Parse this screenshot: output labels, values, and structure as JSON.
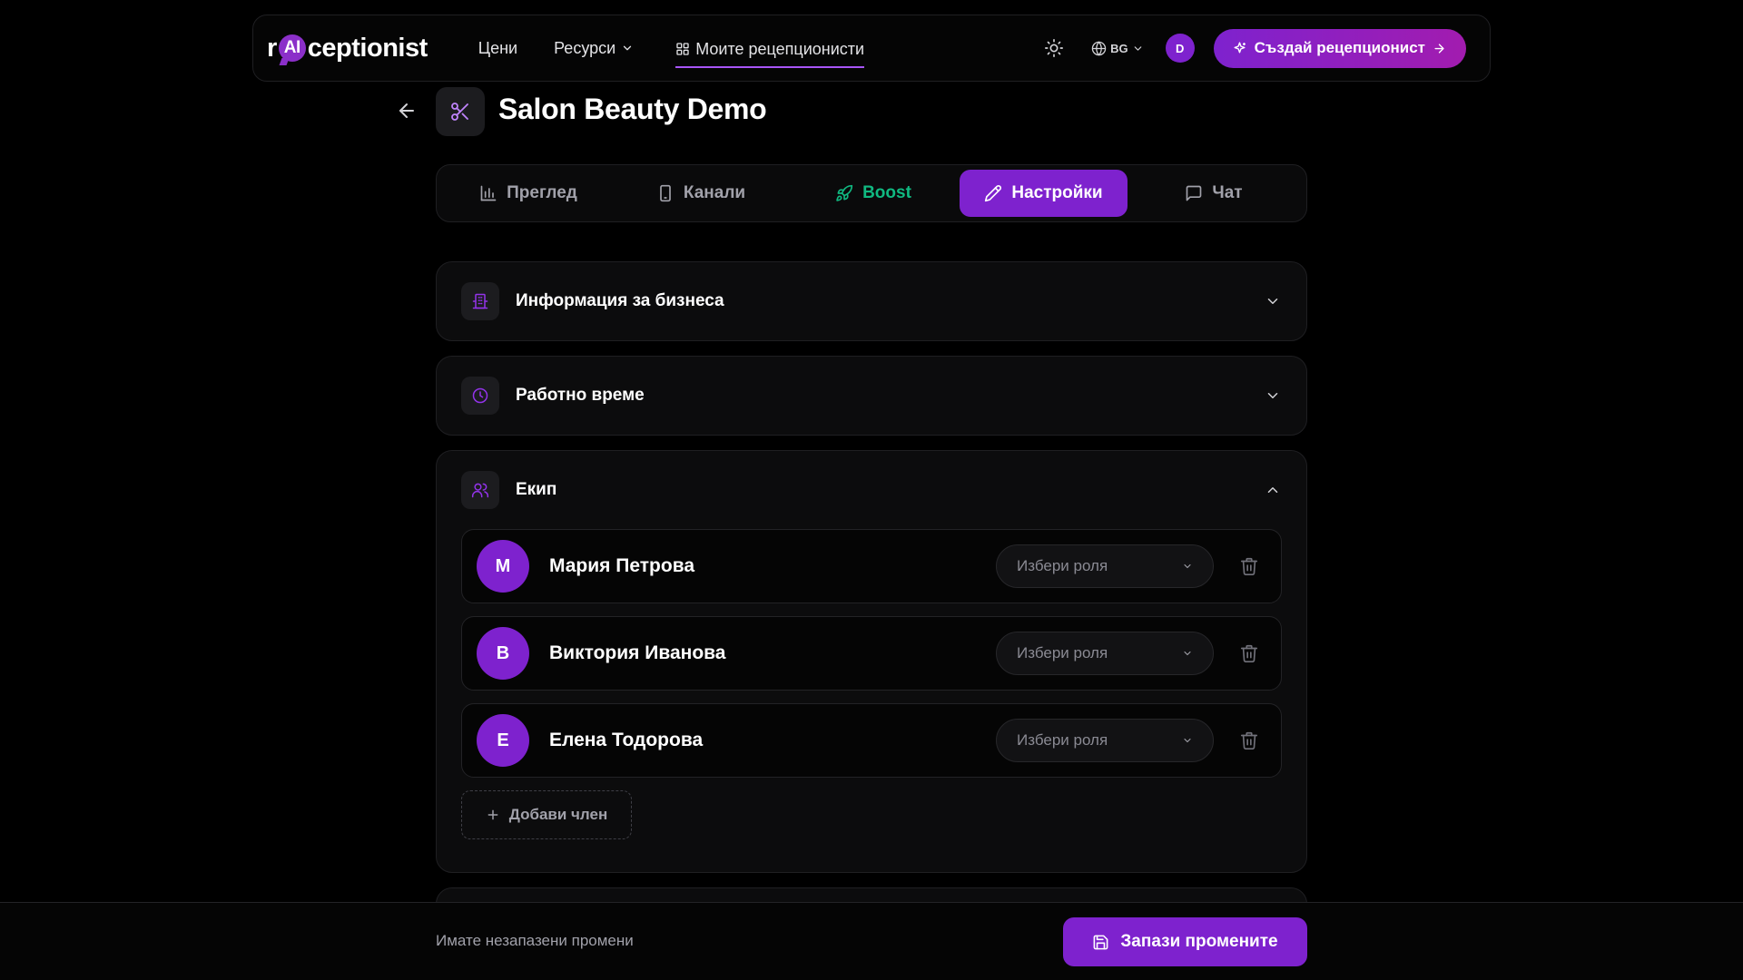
{
  "nav": {
    "logo": {
      "prefix": "r",
      "ai": "AI",
      "suffix": "ceptionist"
    },
    "links": [
      "Цени",
      "Ресурси",
      "Моите рецепционисти"
    ],
    "language": "BG",
    "user_initial": "D",
    "create_button": "Създай рецепционист"
  },
  "page": {
    "title": "Salon Beauty Demo"
  },
  "tabs": [
    {
      "label": "Преглед",
      "icon": "bar-chart-icon"
    },
    {
      "label": "Канали",
      "icon": "phone-icon"
    },
    {
      "label": "Boost",
      "icon": "rocket-icon"
    },
    {
      "label": "Настройки",
      "icon": "pencil-icon",
      "active": true
    },
    {
      "label": "Чат",
      "icon": "message-icon"
    }
  ],
  "sections": {
    "business": {
      "title": "Информация за бизнеса"
    },
    "hours": {
      "title": "Работно време"
    },
    "team": {
      "title": "Екип",
      "role_placeholder": "Избери роля",
      "members": [
        {
          "initial": "М",
          "name": "Мария Петрова"
        },
        {
          "initial": "В",
          "name": "Виктория Иванова"
        },
        {
          "initial": "Е",
          "name": "Елена Тодорова"
        }
      ],
      "add_label": "Добави член"
    }
  },
  "footer": {
    "unsaved_text": "Имате незапазени промени",
    "save_button": "Запази промените"
  },
  "colors": {
    "accent": "#7e22ce",
    "boost": "#10b981",
    "background": "#000000"
  }
}
